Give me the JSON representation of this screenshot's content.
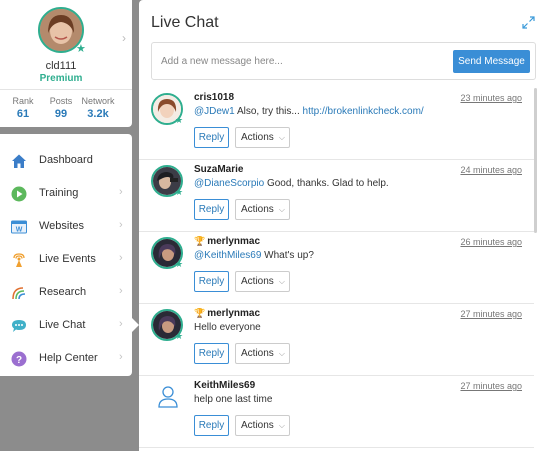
{
  "profile": {
    "username": "cld111",
    "tier": "Premium",
    "stats": [
      {
        "label": "Rank",
        "value": "61"
      },
      {
        "label": "Posts",
        "value": "99"
      },
      {
        "label": "Network",
        "value": "3.2k"
      }
    ]
  },
  "nav": {
    "items": [
      {
        "label": "Dashboard",
        "icon": "home-icon"
      },
      {
        "label": "Training",
        "icon": "play-icon"
      },
      {
        "label": "Websites",
        "icon": "website-icon"
      },
      {
        "label": "Live Events",
        "icon": "broadcast-icon"
      },
      {
        "label": "Research",
        "icon": "research-icon"
      },
      {
        "label": "Live Chat",
        "icon": "chat-icon",
        "active": true
      },
      {
        "label": "Help Center",
        "icon": "help-icon"
      }
    ]
  },
  "chat": {
    "title": "Live Chat",
    "composer_placeholder": "Add a new message here...",
    "send_label": "Send Message",
    "reply_label": "Reply",
    "actions_label": "Actions",
    "messages": [
      {
        "name": "cris1018",
        "time": "23 minutes ago",
        "mention": "@JDew1",
        "text": " Also, try this... ",
        "link": "http://brokenlinkcheck.com/",
        "trophy": false
      },
      {
        "name": "SuzaMarie",
        "time": "24 minutes ago",
        "mention": "@DianeScorpio",
        "text": " Good, thanks. Glad to help.",
        "link": "",
        "trophy": false
      },
      {
        "name": "merlynmac",
        "time": "26 minutes ago",
        "mention": "@KeithMiles69",
        "text": " What's up?",
        "link": "",
        "trophy": true
      },
      {
        "name": "merlynmac",
        "time": "27 minutes ago",
        "mention": "",
        "text": "Hello everyone",
        "link": "",
        "trophy": true
      },
      {
        "name": "KeithMiles69",
        "time": "27 minutes ago",
        "mention": "",
        "text": "help one last time",
        "link": "",
        "trophy": false
      }
    ]
  },
  "colors": {
    "accent": "#3a8ed6",
    "premium": "#2fae8f",
    "link": "#2a7ab8",
    "backdrop": "#8c8c8c"
  }
}
